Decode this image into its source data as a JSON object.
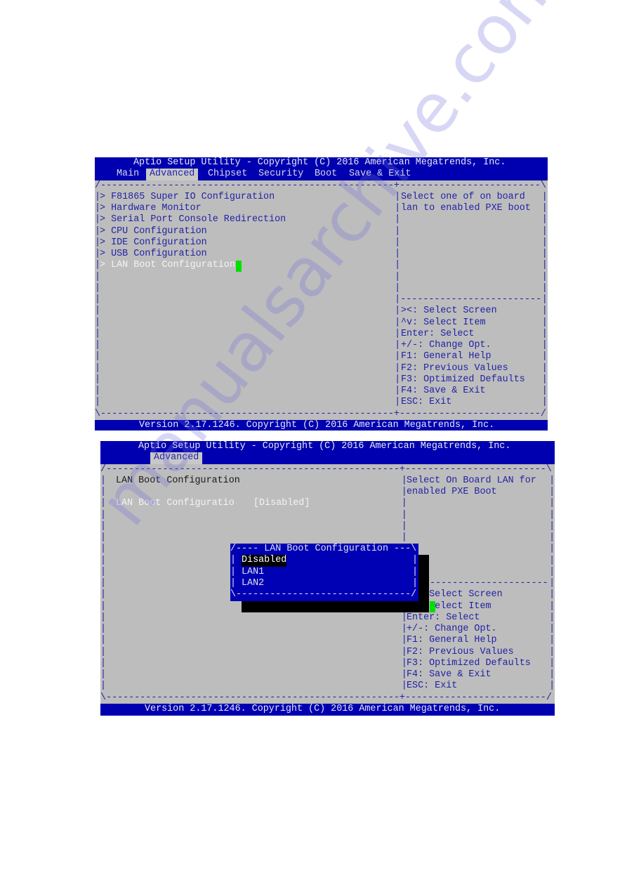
{
  "screen1": {
    "title": "Aptio Setup Utility - Copyright (C) 2016 American Megatrends, Inc.",
    "tabs": [
      "Main",
      "Advanced",
      "Chipset",
      "Security",
      "Boot",
      "Save & Exit"
    ],
    "active_tab": "Advanced",
    "menu_items": [
      "> F81865 Super IO Configuration",
      "> Hardware Monitor",
      "> Serial Port Console Redirection",
      "> CPU Configuration",
      "> IDE Configuration",
      "> USB Configuration",
      "> LAN Boot Configuration"
    ],
    "selected_item": "> LAN Boot Configuration",
    "help_text": [
      "Select one of on board",
      "lan to enabled PXE boot"
    ],
    "keys": [
      "><: Select Screen",
      "^v: Select Item",
      "Enter: Select",
      "+/-: Change Opt.",
      "F1: General Help",
      "F2: Previous Values",
      "F3: Optimized Defaults",
      "F4: Save & Exit",
      "ESC: Exit"
    ],
    "footer": "Version 2.17.1246. Copyright (C) 2016 American Megatrends, Inc."
  },
  "screen2": {
    "title": "Aptio Setup Utility - Copyright (C) 2016 American Megatrends, Inc.",
    "active_tab": "Advanced",
    "section_title": "LAN Boot Configuration",
    "setting_label": "LAN Boot Configuratio",
    "setting_value": "[Disabled]",
    "help_text": [
      "Select On Board LAN for",
      "enabled PXE Boot"
    ],
    "keys": [
      "><: Select Screen",
      "^v: Select Item",
      "Enter: Select",
      "+/-: Change Opt.",
      "F1: General Help",
      "F2: Previous Values",
      "F3: Optimized Defaults",
      "F4: Save & Exit",
      "ESC: Exit"
    ],
    "popup": {
      "title": "LAN Boot Configuration",
      "options": [
        "Disabled",
        "LAN1",
        "LAN2"
      ],
      "selected": "Disabled"
    },
    "footer": "Version 2.17.1246. Copyright (C) 2016 American Megatrends, Inc."
  },
  "watermark": "manualsarchive.com",
  "colors": {
    "header_blue": "#0000b0",
    "body_gray": "#bdbdbd",
    "text_blue": "#2222a6",
    "cursor_green": "#00e000"
  }
}
